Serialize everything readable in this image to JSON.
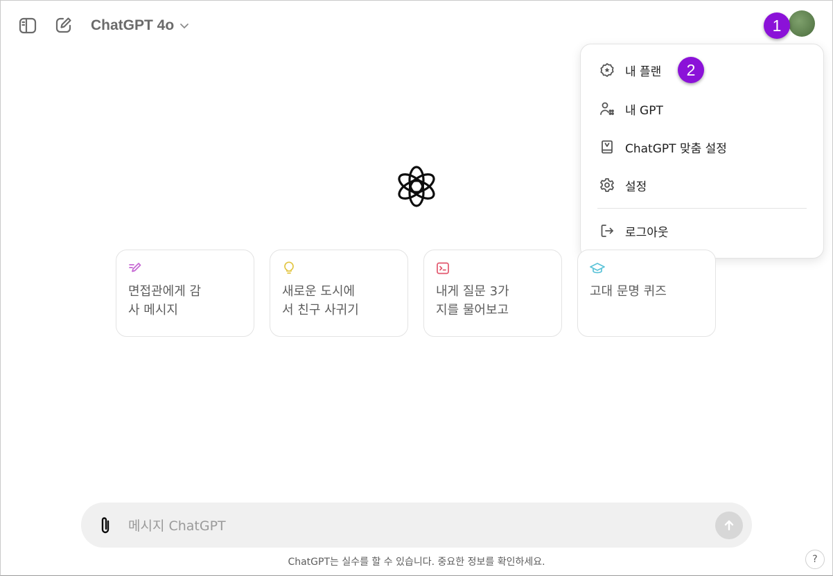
{
  "header": {
    "model_name": "ChatGPT 4o"
  },
  "annotations": {
    "badge_1": "1",
    "badge_2": "2",
    "color": "#8b12d8"
  },
  "profile_menu": {
    "items": [
      {
        "label": "내 플랜",
        "icon": "plan-badge-icon"
      },
      {
        "label": "내 GPT",
        "icon": "my-gpts-icon"
      },
      {
        "label": "ChatGPT 맞춤 설정",
        "icon": "customize-book-icon"
      },
      {
        "label": "설정",
        "icon": "gear-icon"
      },
      {
        "label": "로그아웃",
        "icon": "logout-icon"
      }
    ]
  },
  "suggestions": [
    {
      "text": "면접관에게 감\n사 메시지",
      "icon": "pen-icon",
      "color": "#c566d3"
    },
    {
      "text": "새로운 도시에\n서 친구 사귀기",
      "icon": "lightbulb-icon",
      "color": "#e2c541"
    },
    {
      "text": "내게 질문 3가\n지를 물어보고",
      "icon": "terminal-icon",
      "color": "#e2566c"
    },
    {
      "text": "고대 문명 퀴즈",
      "icon": "graduation-cap-icon",
      "color": "#5bc3d8"
    }
  ],
  "composer": {
    "placeholder": "메시지 ChatGPT"
  },
  "footer": {
    "disclaimer": "ChatGPT는 실수를 할 수 있습니다. 중요한 정보를 확인하세요.",
    "help_label": "?"
  }
}
